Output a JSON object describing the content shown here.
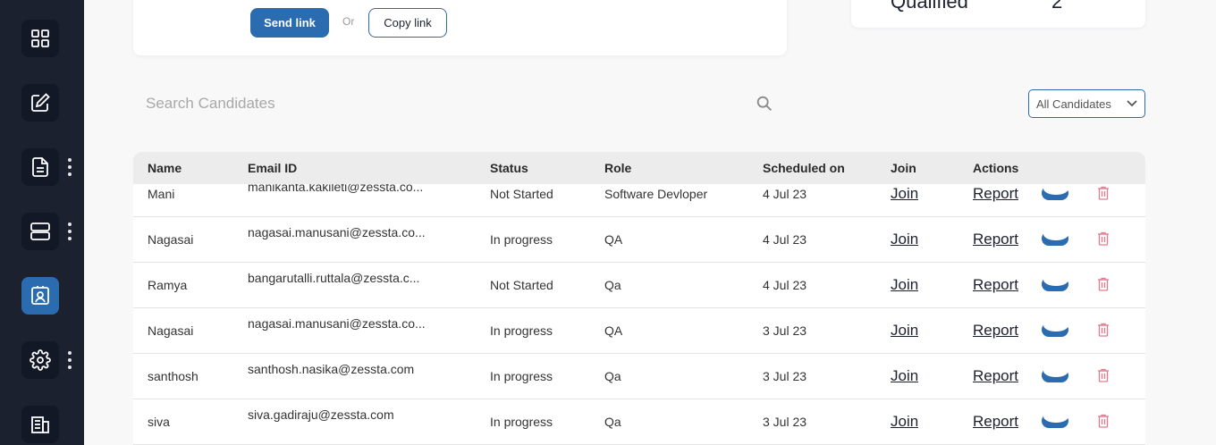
{
  "sidebar": {
    "items": [
      {
        "icon": "grid-icon",
        "active": false
      },
      {
        "icon": "edit-icon",
        "active": false
      },
      {
        "icon": "document-icon",
        "active": false,
        "has_menu": true
      },
      {
        "icon": "server-icon",
        "active": false,
        "has_menu": true
      },
      {
        "icon": "candidate-icon",
        "active": true
      },
      {
        "icon": "gear-icon",
        "active": false,
        "has_menu": true
      },
      {
        "icon": "building-icon",
        "active": false
      }
    ]
  },
  "invite": {
    "send_label": "Send link",
    "or_label": "Or",
    "copy_label": "Copy link"
  },
  "stats": {
    "qualified_label": "Qualified",
    "qualified_value": "2"
  },
  "search": {
    "placeholder": "Search Candidates",
    "value": ""
  },
  "filter": {
    "selected": "All Candidates"
  },
  "table": {
    "columns": [
      "Name",
      "Email ID",
      "Status",
      "Role",
      "Scheduled on",
      "Join",
      "Actions"
    ],
    "rows": [
      {
        "name": "Mani",
        "email": "manikanta.kakileti@zessta.co...",
        "status": "Not Started",
        "role": "Software Devloper",
        "date": "4 Jul 23",
        "join": "Join",
        "report": "Report"
      },
      {
        "name": "Nagasai",
        "email": "nagasai.manusani@zessta.co...",
        "status": "In progress",
        "role": "QA",
        "date": "4 Jul 23",
        "join": "Join",
        "report": "Report"
      },
      {
        "name": "Ramya",
        "email": "bangarutalli.ruttala@zessta.c...",
        "status": "Not Started",
        "role": "Qa",
        "date": "4 Jul 23",
        "join": "Join",
        "report": "Report"
      },
      {
        "name": "Nagasai",
        "email": "nagasai.manusani@zessta.co...",
        "status": "In progress",
        "role": "QA",
        "date": "3 Jul 23",
        "join": "Join",
        "report": "Report"
      },
      {
        "name": "santhosh",
        "email": "santhosh.nasika@zessta.com",
        "status": "In progress",
        "role": "Qa",
        "date": "3 Jul 23",
        "join": "Join",
        "report": "Report"
      },
      {
        "name": "siva",
        "email": "siva.gadiraju@zessta.com",
        "status": "In progress",
        "role": "Qa",
        "date": "3 Jul 23",
        "join": "Join",
        "report": "Report"
      }
    ]
  },
  "colors": {
    "sidebar_bg": "#1c2130",
    "accent": "#2b6cb0",
    "trash": "#e57a8f"
  }
}
